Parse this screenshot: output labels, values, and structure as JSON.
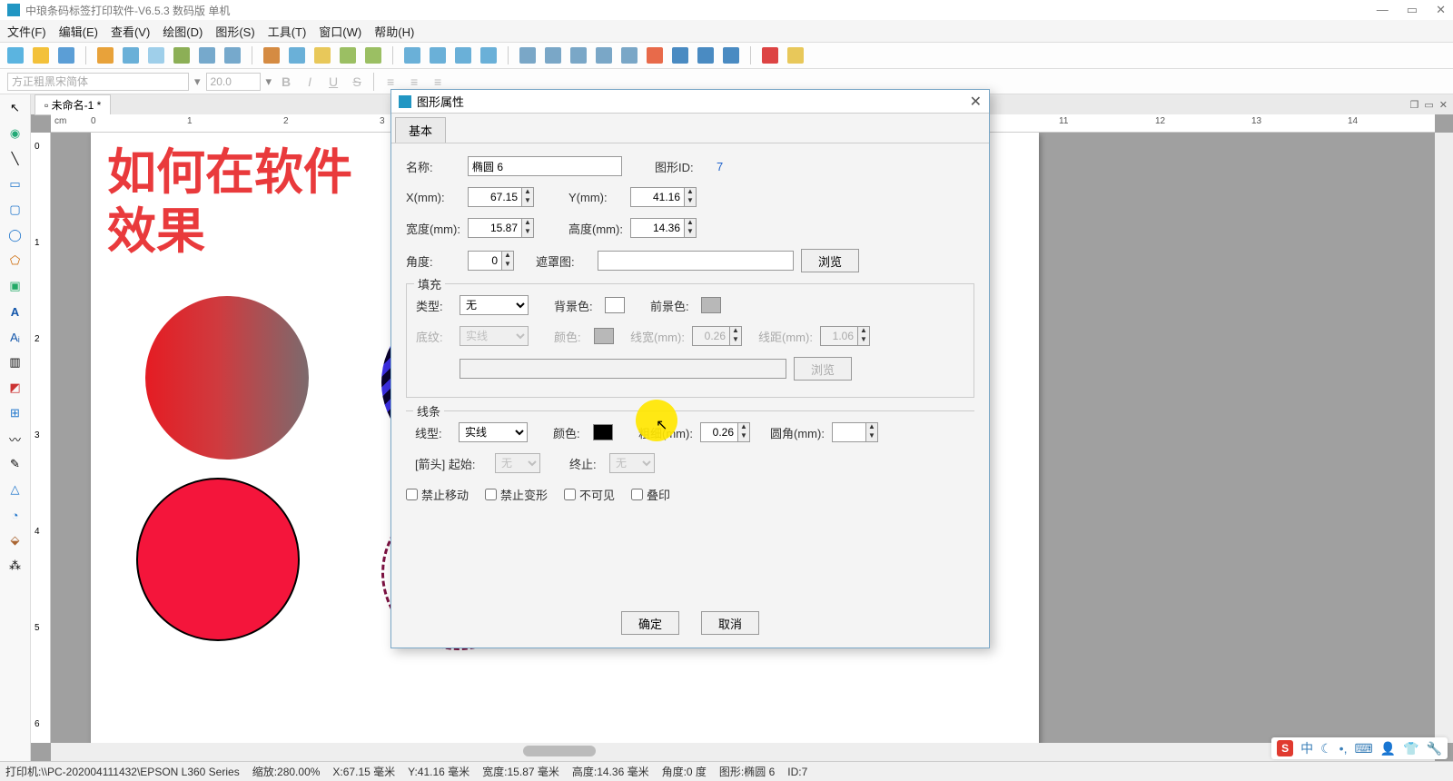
{
  "window": {
    "title": "中琅条码标签打印软件-V6.5.3 数码版 单机"
  },
  "menu": {
    "file": "文件(F)",
    "edit": "编辑(E)",
    "view": "查看(V)",
    "draw": "绘图(D)",
    "shape": "图形(S)",
    "tool": "工具(T)",
    "window": "窗口(W)",
    "help": "帮助(H)"
  },
  "format_bar": {
    "font_name": "方正粗黑宋简体",
    "font_size": "20.0"
  },
  "doc": {
    "tab_title": "未命名-1 *",
    "ruler_unit": "cm",
    "headline_l1": "如何在软件",
    "headline_l2": "效果"
  },
  "hruler_ticks": [
    "0",
    "1",
    "2",
    "3",
    "11",
    "12",
    "13",
    "14"
  ],
  "vruler_ticks": [
    "0",
    "1",
    "2",
    "3",
    "4",
    "5",
    "6"
  ],
  "dialog": {
    "title": "图形属性",
    "tab_basic": "基本",
    "name_label": "名称:",
    "name_value": "椭圆 6",
    "id_label": "图形ID:",
    "id_value": "7",
    "x_label": "X(mm):",
    "x_value": "67.15",
    "y_label": "Y(mm):",
    "y_value": "41.16",
    "w_label": "宽度(mm):",
    "w_value": "15.87",
    "h_label": "高度(mm):",
    "h_value": "14.36",
    "angle_label": "角度:",
    "angle_value": "0",
    "mask_label": "遮罩图:",
    "mask_value": "",
    "browse": "浏览",
    "fill_legend": "填充",
    "fill_type_label": "类型:",
    "fill_type_value": "无",
    "bg_label": "背景色:",
    "fg_label": "前景色:",
    "hatch_label": "底纹:",
    "hatch_value": "实线",
    "hcolor_label": "颜色:",
    "lw_label": "线宽(mm):",
    "lw_value": "0.26",
    "ls_label": "线距(mm):",
    "ls_value": "1.06",
    "line_legend": "线条",
    "line_type_label": "线型:",
    "line_type_value": "实线",
    "line_color_label": "颜色:",
    "line_weight_label": "粗细(mm):",
    "line_weight_value": "0.26",
    "corner_label": "圆角(mm):",
    "corner_value": "",
    "arrow_label": "[箭头] 起始:",
    "arrow_end_label": "终止:",
    "arrow_none": "无",
    "chk_lock_move": "禁止移动",
    "chk_lock_transform": "禁止变形",
    "chk_invisible": "不可见",
    "chk_overprint": "叠印",
    "ok": "确定",
    "cancel": "取消"
  },
  "status": {
    "printer": "打印机:\\\\PC-202004111432\\EPSON L360 Series",
    "zoom": "缩放:280.00%",
    "x": "X:67.15 毫米",
    "y": "Y:41.16 毫米",
    "w": "宽度:15.87 毫米",
    "h": "高度:14.36 毫米",
    "angle": "角度:0 度",
    "shape": "图形:椭圆 6",
    "id": "ID:7"
  },
  "tray": {
    "ime": "S",
    "txt": "中"
  }
}
